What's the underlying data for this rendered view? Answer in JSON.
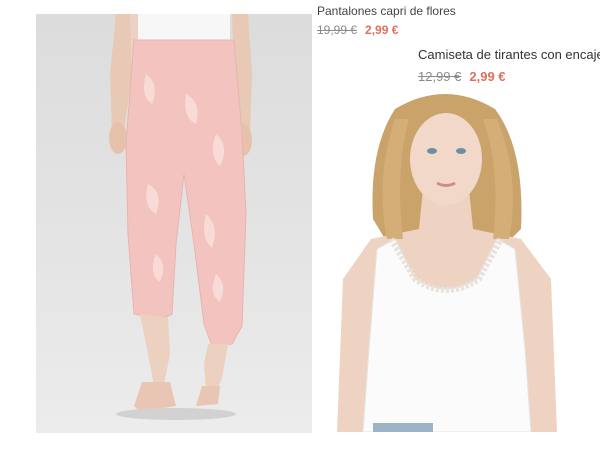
{
  "products": [
    {
      "title": "Pantalones capri de flores",
      "price_old": "19,99 €",
      "price_new": "2,99 €",
      "image_subject": "model wearing pink floral capri pants, barefoot, grey studio background"
    },
    {
      "title": "Camiseta de tirantes con encaje",
      "price_old": "12,99 €",
      "price_new": "2,99 €",
      "image_subject": "blonde model wearing white tank top with lace trim"
    }
  ],
  "colors": {
    "sale_price": "#e0705f",
    "old_price": "#8a8a8a",
    "title_text": "#444444",
    "pants_pink": "#f3c4bf",
    "photo_background": "#dedede"
  }
}
